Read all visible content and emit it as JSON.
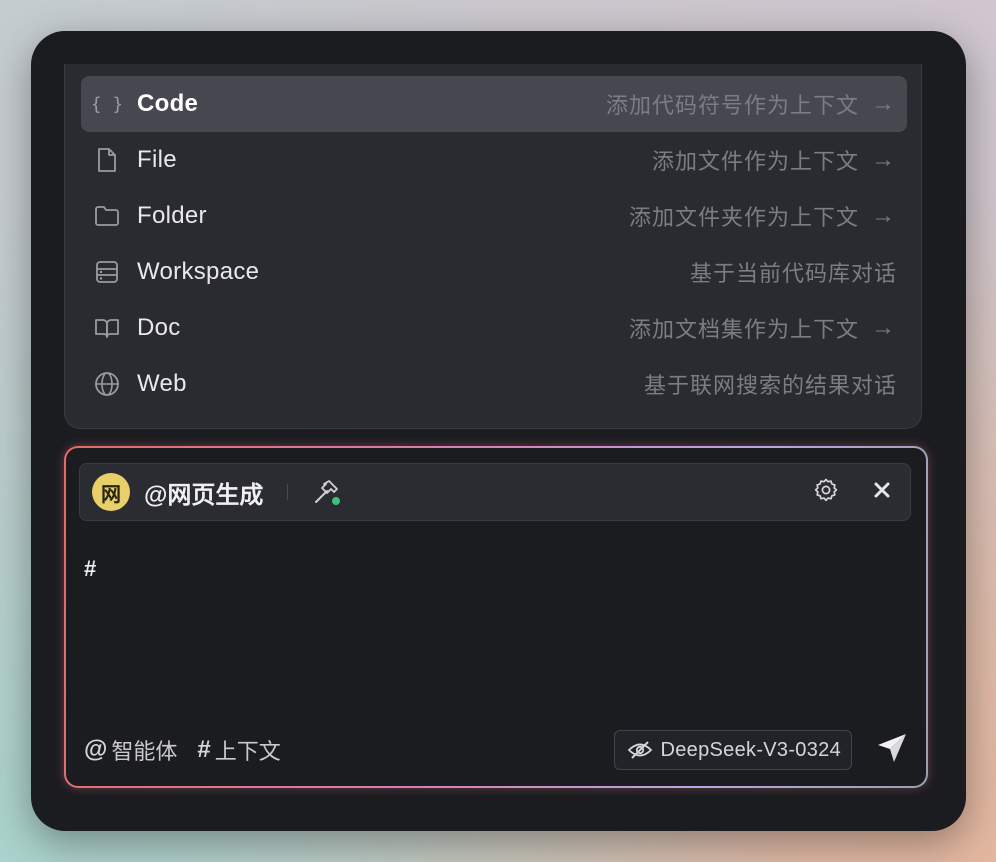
{
  "menu": {
    "items": [
      {
        "label": "Code",
        "desc": "添加代码符号作为上下文",
        "arrow": "→",
        "icon": "braces-icon",
        "active": true
      },
      {
        "label": "File",
        "desc": "添加文件作为上下文",
        "arrow": "→",
        "icon": "file-icon"
      },
      {
        "label": "Folder",
        "desc": "添加文件夹作为上下文",
        "arrow": "→",
        "icon": "folder-icon"
      },
      {
        "label": "Workspace",
        "desc": "基于当前代码库对话",
        "icon": "database-icon"
      },
      {
        "label": "Doc",
        "desc": "添加文档集作为上下文",
        "arrow": "→",
        "icon": "book-icon"
      },
      {
        "label": "Web",
        "desc": "基于联网搜索的结果对话",
        "icon": "globe-icon"
      }
    ]
  },
  "agent": {
    "avatar_text": "网",
    "name": "@网页生成",
    "avatar_color": "#e6d067",
    "tool_status_color": "#3fbf7a"
  },
  "input": {
    "text": "#"
  },
  "footer": {
    "agent_symbol": "@",
    "agent_label": "智能体",
    "context_symbol": "#",
    "context_label": "上下文",
    "model": "DeepSeek-V3-0324"
  },
  "colors": {
    "window_bg": "#1b1c20",
    "menu_bg": "#2a2b30",
    "menu_active_bg": "#46474f",
    "glow_start": "#e46b66",
    "glow_mid": "#d77fb5",
    "glow_end": "#b6a6e3"
  }
}
